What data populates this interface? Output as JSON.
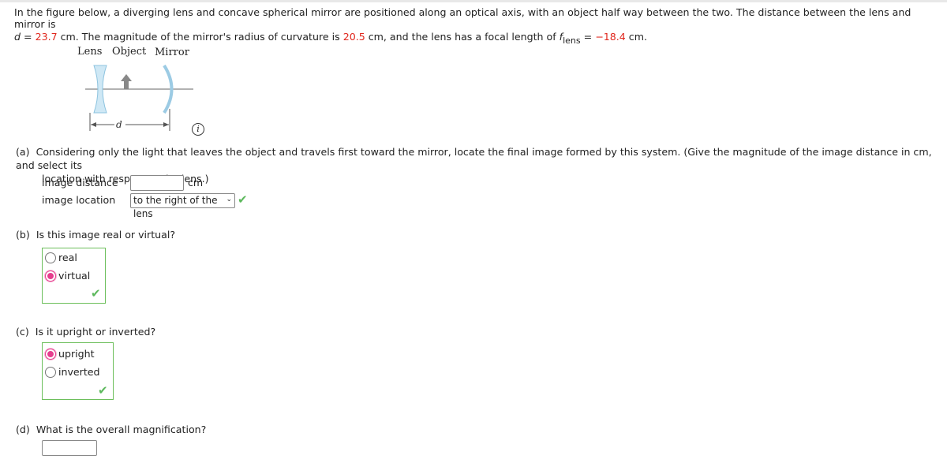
{
  "problem": {
    "line1": "In the figure below, a diverging lens and concave spherical mirror are positioned along an optical axis, with an object half way between the two. The distance between the lens and mirror is",
    "d_var": "d",
    "eq": " = ",
    "d_value": "23.7",
    "t1": " cm. The magnitude of the mirror's radius of curvature is ",
    "r_value": "20.5",
    "t2": " cm, and the lens has a focal length of ",
    "f_var": "f",
    "f_sub": "lens",
    "eq2": " = ",
    "f_value": "−18.4",
    "t3": " cm."
  },
  "figure": {
    "lens_label": "Lens",
    "object_label": "Object",
    "mirror_label": "Mirror",
    "d_label": "d",
    "info_icon": "i"
  },
  "part_a": {
    "label": "(a)",
    "question": "Considering only the light that leaves the object and travels first toward the mirror, locate the final image formed by this system. (Give the magnitude of the image distance in cm, and select its",
    "question2": "location with respect to the lens.)",
    "distance_label": "image distance",
    "distance_value": "",
    "unit": "cm",
    "location_label": "image location",
    "location_value": "to the right of the lens",
    "correct": true
  },
  "part_b": {
    "label": "(b)",
    "question": "Is this image real or virtual?",
    "options": [
      "real",
      "virtual"
    ],
    "selected": "virtual",
    "correct": true
  },
  "part_c": {
    "label": "(c)",
    "question": "Is it upright or inverted?",
    "options": [
      "upright",
      "inverted"
    ],
    "selected": "upright",
    "correct": true
  },
  "part_d": {
    "label": "(d)",
    "question": "What is the overall magnification?",
    "value": ""
  },
  "colors": {
    "highlight": "#e0261c",
    "correct": "#5cb85c",
    "radio": "#e63d8e"
  }
}
